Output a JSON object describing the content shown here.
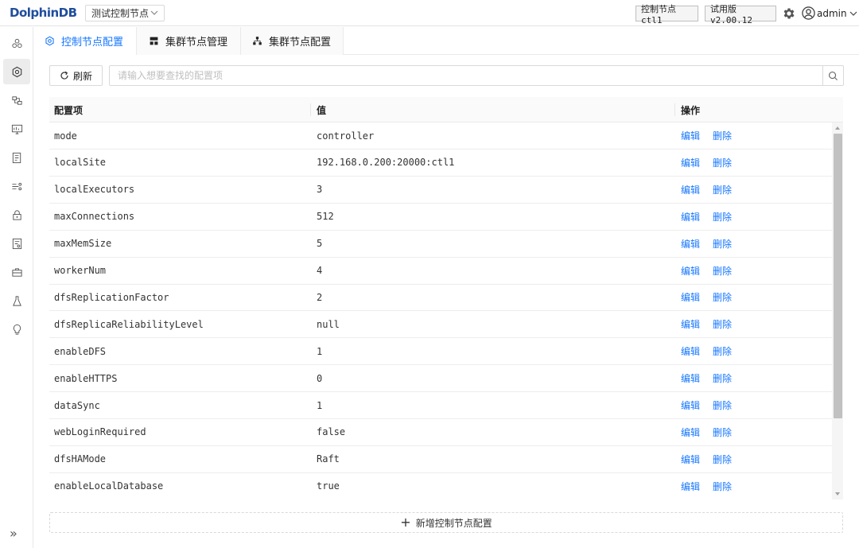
{
  "header": {
    "logo_prefix": "D",
    "logo_mid": "olphin",
    "logo_suffix": "DB",
    "node_select": "测试控制节点",
    "node_tag": "控制节点 ctl1",
    "version_tag": "试用版 v2.00.12",
    "user": "admin"
  },
  "sidebar": {
    "icons": [
      "overview-icon",
      "config-icon",
      "cluster-icon",
      "monitor-icon",
      "log-icon",
      "stream-icon",
      "lock-icon",
      "doc-icon",
      "toolbox-icon",
      "lab-icon",
      "bulb-icon"
    ],
    "active_index": 1,
    "expand": "»"
  },
  "tabs": [
    {
      "label": "控制节点配置",
      "icon": "settings-icon",
      "active": true
    },
    {
      "label": "集群节点管理",
      "icon": "cluster-manage-icon",
      "active": false
    },
    {
      "label": "集群节点配置",
      "icon": "cluster-config-icon",
      "active": false
    }
  ],
  "toolbar": {
    "refresh_label": "刷新",
    "search_placeholder": "请输入想要查找的配置项"
  },
  "table": {
    "columns": [
      "配置项",
      "值",
      "操作"
    ],
    "edit_label": "编辑",
    "delete_label": "删除",
    "rows": [
      {
        "key": "mode",
        "value": "controller"
      },
      {
        "key": "localSite",
        "value": "192.168.0.200:20000:ctl1"
      },
      {
        "key": "localExecutors",
        "value": "3"
      },
      {
        "key": "maxConnections",
        "value": "512"
      },
      {
        "key": "maxMemSize",
        "value": "5"
      },
      {
        "key": "workerNum",
        "value": "4"
      },
      {
        "key": "dfsReplicationFactor",
        "value": "2"
      },
      {
        "key": "dfsReplicaReliabilityLevel",
        "value": "null"
      },
      {
        "key": "enableDFS",
        "value": "1"
      },
      {
        "key": "enableHTTPS",
        "value": "0"
      },
      {
        "key": "dataSync",
        "value": "1"
      },
      {
        "key": "webLoginRequired",
        "value": "false"
      },
      {
        "key": "dfsHAMode",
        "value": "Raft"
      },
      {
        "key": "enableLocalDatabase",
        "value": "true"
      }
    ]
  },
  "add_button": {
    "plus": "+",
    "label": "新增控制节点配置"
  },
  "colors": {
    "accent": "#1677ff",
    "logo": "#1f4e9c"
  }
}
